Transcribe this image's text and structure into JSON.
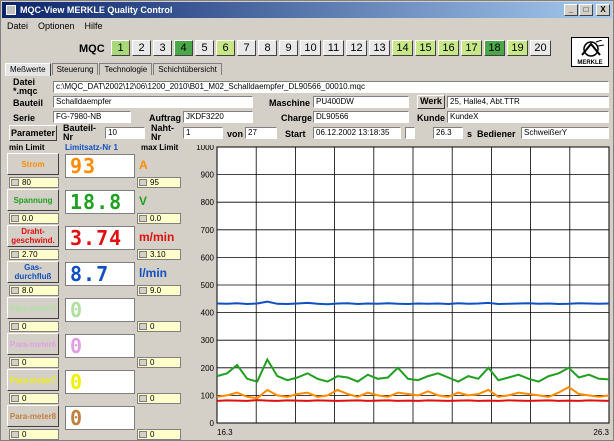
{
  "window": {
    "title": "MQC-View   MERKLE Quality Control",
    "buttons": [
      "_",
      "□",
      "X"
    ]
  },
  "menu": [
    "Datei",
    "Optionen",
    "Hilfe"
  ],
  "toolbar": {
    "label": "MQC",
    "channels": [
      {
        "n": "1",
        "color": "#a8d878"
      },
      {
        "n": "2",
        "color": "#e8e8e8"
      },
      {
        "n": "3",
        "color": "#e8e8e8"
      },
      {
        "n": "4",
        "color": "#4aa84a"
      },
      {
        "n": "5",
        "color": "#e8e8e8"
      },
      {
        "n": "6",
        "color": "#c8e888"
      },
      {
        "n": "7",
        "color": "#e8e8e8"
      },
      {
        "n": "8",
        "color": "#e8e8e8"
      },
      {
        "n": "9",
        "color": "#e8e8e8"
      },
      {
        "n": "10",
        "color": "#e8e8e8"
      },
      {
        "n": "11",
        "color": "#e8e8e8"
      },
      {
        "n": "12",
        "color": "#e8e8e8"
      },
      {
        "n": "13",
        "color": "#e8e8e8"
      },
      {
        "n": "14",
        "color": "#c8e888"
      },
      {
        "n": "15",
        "color": "#c8e888"
      },
      {
        "n": "16",
        "color": "#c8e888"
      },
      {
        "n": "17",
        "color": "#c8e888"
      },
      {
        "n": "18",
        "color": "#4aa84a"
      },
      {
        "n": "19",
        "color": "#c8e888"
      },
      {
        "n": "20",
        "color": "#e8e8e8"
      }
    ],
    "logo_text": "MERKLE"
  },
  "tabs": [
    "Meßwerte",
    "Steuerung",
    "Technologie",
    "Schichtübersicht"
  ],
  "info": {
    "datei_label": "Datei *.mqc",
    "datei": "c:\\MQC_DAT\\2002\\12\\06\\1200_2010\\B01_M02_Schalldaempfer_DL90566_00010.mqc",
    "bauteil_label": "Bauteil",
    "bauteil": "Schalldaempfer",
    "maschine_label": "Maschine",
    "maschine": "PU400DW",
    "werk_label": "Werk",
    "werk": "25, Halle4, Abt.TTR",
    "serie_label": "Serie",
    "serie": "FG-7980-NB",
    "auftrag_label": "Auftrag",
    "auftrag": "JKDF3220",
    "charge_label": "Charge",
    "charge": "DL90566",
    "kunde_label": "Kunde",
    "kunde": "KundeX",
    "parameter_btn": "Parameter",
    "bauteil_nr_label": "Bauteil-Nr",
    "bauteil_nr": "10",
    "naht_nr_label": "Naht-Nr",
    "naht_nr": "1",
    "von_label": "von",
    "von": "27",
    "start_label": "Start",
    "start": "06.12.2002 13:18:35",
    "duration": "26.3",
    "duration_unit": "s",
    "bediener_label": "Bediener",
    "bediener": "SchweißerY"
  },
  "limits": {
    "min_label": "min Limit",
    "set_label": "Limitsatz-Nr 1",
    "max_label": "max Limit"
  },
  "params": [
    {
      "name": "Strom",
      "min": "80",
      "max": "95",
      "value": "93",
      "unit": "A",
      "color": "#ff8c00",
      "active": true
    },
    {
      "name": "Spannung",
      "min": "0.0",
      "max": "0.0",
      "value": "18.8",
      "unit": "V",
      "color": "#20a020",
      "active": true
    },
    {
      "name": "Draht-geschwind.",
      "min": "2.70",
      "max": "3.10",
      "value": "3.74",
      "unit": "m/min",
      "color": "#e01010",
      "active": true
    },
    {
      "name": "Gas-durchfluß",
      "min": "8.0",
      "max": "9.0",
      "value": "8.7",
      "unit": "l/min",
      "color": "#1050c0",
      "active": true
    },
    {
      "name": "Para-meter5",
      "min": "0",
      "max": "0",
      "value": "0",
      "unit": "",
      "color": "#b0e0a0",
      "active": false
    },
    {
      "name": "Para-meter6",
      "min": "0",
      "max": "0",
      "value": "0",
      "unit": "",
      "color": "#e0a0e0",
      "active": false
    },
    {
      "name": "Para-meter7",
      "min": "0",
      "max": "0",
      "value": "0",
      "unit": "",
      "color": "#f0f000",
      "active": false
    },
    {
      "name": "Para-meter8",
      "min": "0",
      "max": "0",
      "value": "0",
      "unit": "",
      "color": "#c08040",
      "active": false
    }
  ],
  "chart_data": {
    "type": "line",
    "ylim": [
      0,
      1000
    ],
    "xlim": [
      16.3,
      26.3
    ],
    "y_ticks": [
      "0",
      "100",
      "200",
      "300",
      "400",
      "500",
      "600",
      "700",
      "800",
      "900",
      "1000"
    ],
    "x_tick_labels": [
      "16.3",
      "26.3"
    ],
    "grid": true,
    "series": [
      {
        "color": "#1050c0",
        "values": [
          433,
          432,
          434,
          431,
          433,
          440,
          432,
          431,
          433,
          435,
          432,
          430,
          433,
          434,
          431,
          433,
          432,
          434,
          432,
          431,
          433,
          432,
          433,
          431,
          434,
          432,
          433,
          435,
          431,
          432,
          433,
          434,
          432,
          433,
          431,
          432,
          434,
          433,
          432,
          433
        ]
      },
      {
        "color": "#20a020",
        "values": [
          170,
          180,
          210,
          160,
          150,
          230,
          170,
          155,
          165,
          180,
          160,
          150,
          170,
          165,
          150,
          175,
          160,
          165,
          200,
          160,
          155,
          170,
          180,
          165,
          150,
          170,
          160,
          200,
          155,
          165,
          175,
          160,
          150,
          170,
          180,
          200,
          165,
          175,
          160,
          158
        ]
      },
      {
        "color": "#ff8c00",
        "values": [
          95,
          100,
          110,
          95,
          90,
          120,
          100,
          95,
          105,
          110,
          95,
          100,
          120,
          105,
          95,
          110,
          100,
          95,
          110,
          105,
          100,
          115,
          100,
          95,
          110,
          100,
          105,
          120,
          95,
          100,
          110,
          105,
          100,
          95,
          110,
          130,
          105,
          100,
          95,
          100
        ]
      },
      {
        "color": "#e01010",
        "values": [
          80,
          82,
          81,
          80,
          83,
          81,
          80,
          82,
          81,
          80,
          82,
          81,
          80,
          81,
          82,
          80,
          81,
          82,
          80,
          81,
          80,
          82,
          81,
          80,
          81,
          82,
          80,
          81,
          80,
          82,
          81,
          80,
          81,
          82,
          80,
          81,
          80,
          82,
          81,
          80
        ]
      }
    ]
  }
}
